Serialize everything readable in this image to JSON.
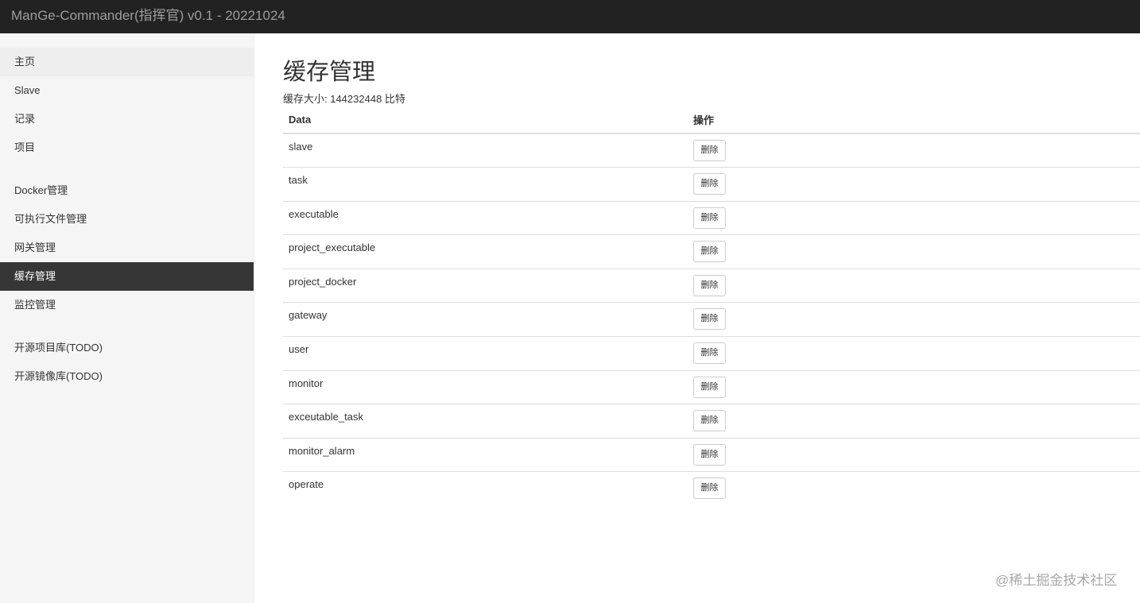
{
  "header": {
    "title": "ManGe-Commander(指挥官) v0.1 - 20221024"
  },
  "sidebar": {
    "groups": [
      {
        "items": [
          {
            "label": "主页"
          },
          {
            "label": "Slave"
          },
          {
            "label": "记录"
          },
          {
            "label": "项目"
          }
        ]
      },
      {
        "items": [
          {
            "label": "Docker管理"
          },
          {
            "label": "可执行文件管理"
          },
          {
            "label": "网关管理"
          },
          {
            "label": "缓存管理"
          },
          {
            "label": "监控管理"
          }
        ]
      },
      {
        "items": [
          {
            "label": "开源项目库(TODO)"
          },
          {
            "label": "开源镜像库(TODO)"
          }
        ]
      }
    ],
    "active": "缓存管理"
  },
  "main": {
    "title": "缓存管理",
    "cache_size_label": "缓存大小: 144232448 比特",
    "table": {
      "headers": [
        "Data",
        "操作"
      ],
      "delete_label": "删除",
      "rows": [
        "slave",
        "task",
        "executable",
        "project_executable",
        "project_docker",
        "gateway",
        "user",
        "monitor",
        "exceutable_task",
        "monitor_alarm",
        "operate"
      ]
    }
  },
  "watermark": "@稀土掘金技术社区",
  "colors": {
    "navbar": "#222222",
    "sidebar": "#f5f5f5",
    "active_item": "#363636"
  }
}
